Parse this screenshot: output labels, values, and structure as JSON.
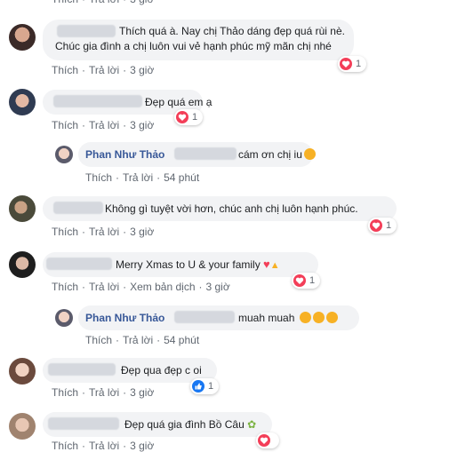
{
  "comments": [
    {
      "text": "Thích quá à. Nay chị Thảo dáng đẹp quá rùi nè.",
      "text2": "Chúc gia đình a chị luôn vui vẻ hạnh phúc mỹ mãn chị nhé",
      "like": "Thích",
      "reply": "Trả lời",
      "time": "3 giờ",
      "reaction_count": "1"
    },
    {
      "text": "Đẹp quá em ạ",
      "like": "Thích",
      "reply": "Trả lời",
      "time": "3 giờ",
      "reaction_count": "1"
    },
    {
      "name": "Phan Như Thảo",
      "text": "cám ơn chị iu",
      "like": "Thích",
      "reply": "Trả lời",
      "time": "54 phút"
    },
    {
      "text": "Không gì tuyệt vời hơn, chúc anh chị luôn hạnh phúc.",
      "like": "Thích",
      "reply": "Trả lời",
      "time": "3 giờ",
      "reaction_count": "1"
    },
    {
      "text": "Merry Xmas to U & your family",
      "like": "Thích",
      "reply": "Trả lời",
      "translate": "Xem bản dịch",
      "time": "3 giờ",
      "reaction_count": "1"
    },
    {
      "name": "Phan Như Thảo",
      "text": "muah muah",
      "like": "Thích",
      "reply": "Trả lời",
      "time": "54 phút"
    },
    {
      "text": "Đẹp qua đẹp c oi",
      "like": "Thích",
      "reply": "Trả lời",
      "time": "3 giờ",
      "reaction_count": "1"
    },
    {
      "text": "Đẹp quá gia đình Bồ Câu",
      "like": "Thích",
      "reply": "Trả lời",
      "time": "3 giờ"
    }
  ],
  "icons": {
    "heart": "heart-reaction-icon",
    "like": "like-reaction-icon",
    "emoji": "kiss-emoji-icon"
  },
  "colors": {
    "name": "#385898",
    "bubble": "#f2f3f5",
    "heart": "#f33e58",
    "like": "#1877f2"
  }
}
